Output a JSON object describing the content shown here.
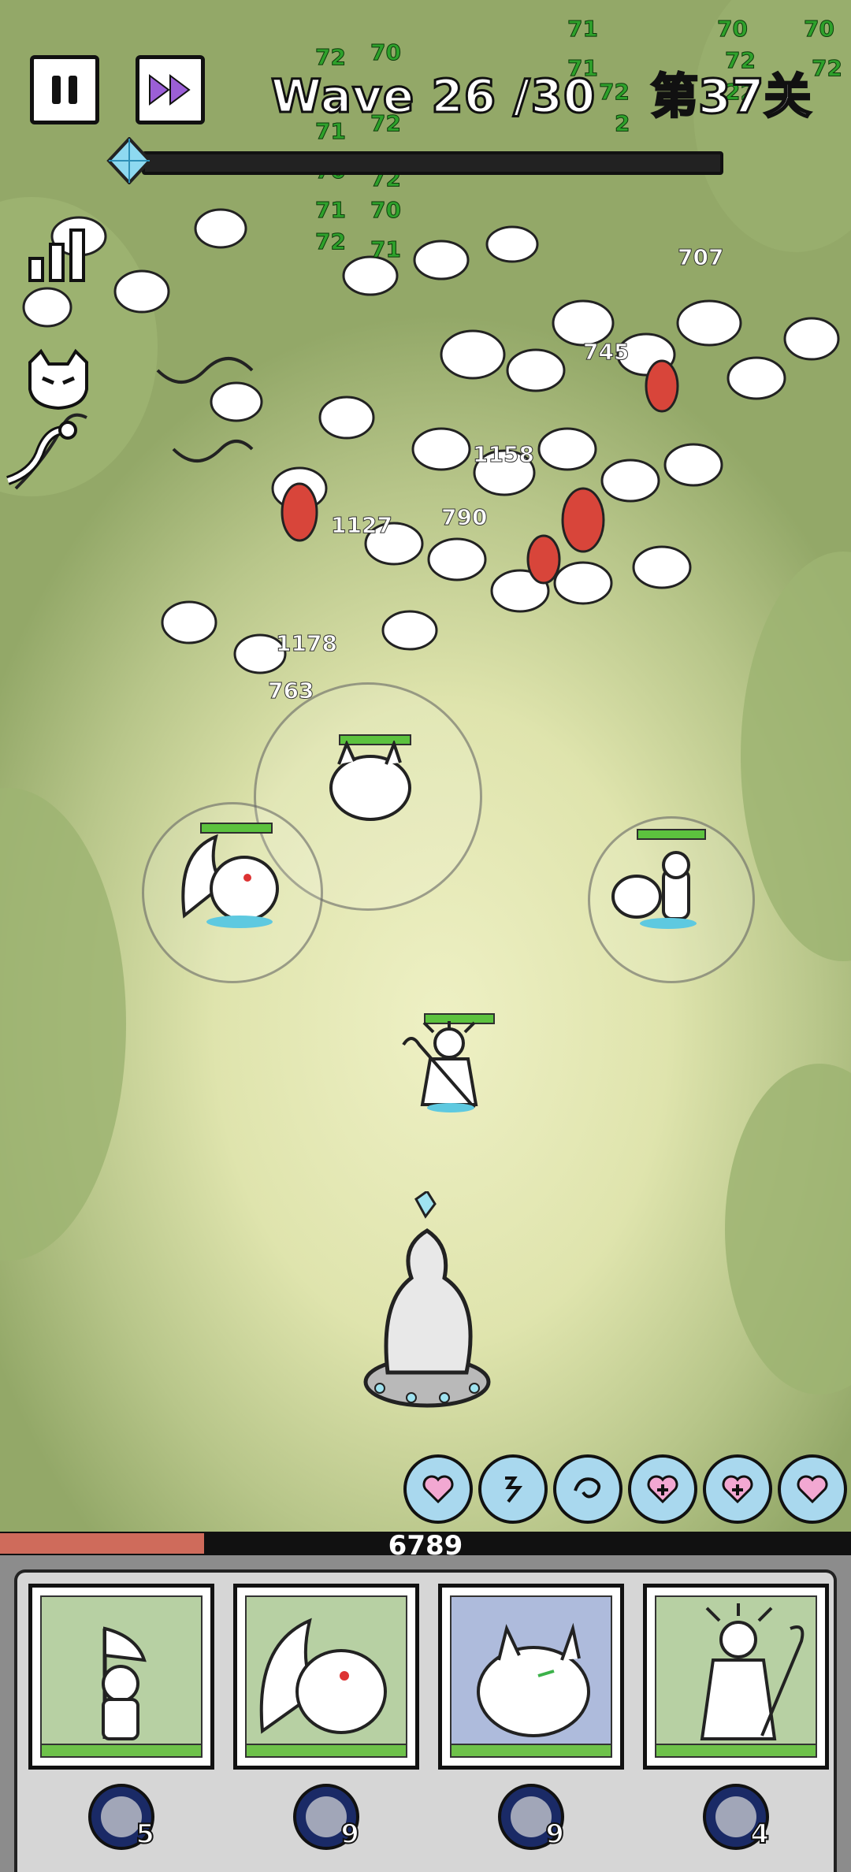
{
  "hud": {
    "wave_text": "Wave 26 /30",
    "level_text": "第37关",
    "base_hp_value": "6789",
    "base_hp_fraction": 0.24,
    "wave_progress_fraction": 0.0
  },
  "buttons": {
    "pause_icon": "pause-icon",
    "fast_forward_icon": "fast-forward-icon"
  },
  "side_icons": [
    "stats-bars-icon",
    "demon-cat-icon",
    "snake-icon"
  ],
  "damage_numbers": [
    "72",
    "70",
    "71",
    "72",
    "70",
    "72",
    "71",
    "70",
    "72",
    "71",
    "72",
    "70",
    "72",
    "70",
    "71",
    "72",
    "22",
    "71",
    "1127",
    "790",
    "1178",
    "763",
    "707",
    "1158",
    "745",
    "2"
  ],
  "skills": [
    {
      "icon": "heart-icon"
    },
    {
      "icon": "rune-icon"
    },
    {
      "icon": "swirl-icon"
    },
    {
      "icon": "heal-plus-icon"
    },
    {
      "icon": "heal-plus-icon"
    },
    {
      "icon": "heart-icon"
    }
  ],
  "cards": [
    {
      "name": "knight-with-flag",
      "cost": "5",
      "accent": "#b7d0a3"
    },
    {
      "name": "winged-demon",
      "cost": "9",
      "accent": "#b7d0a3"
    },
    {
      "name": "horned-beast",
      "cost": "9",
      "accent": "#aebbdc"
    },
    {
      "name": "antlered-mage",
      "cost": "4",
      "accent": "#b7d0a3"
    }
  ],
  "colors": {
    "damage_green": "#2ea12b",
    "hp_red": "#cf6b5b",
    "skill_blue": "#a9d8ee",
    "card_bar_green": "#6ec24a"
  }
}
